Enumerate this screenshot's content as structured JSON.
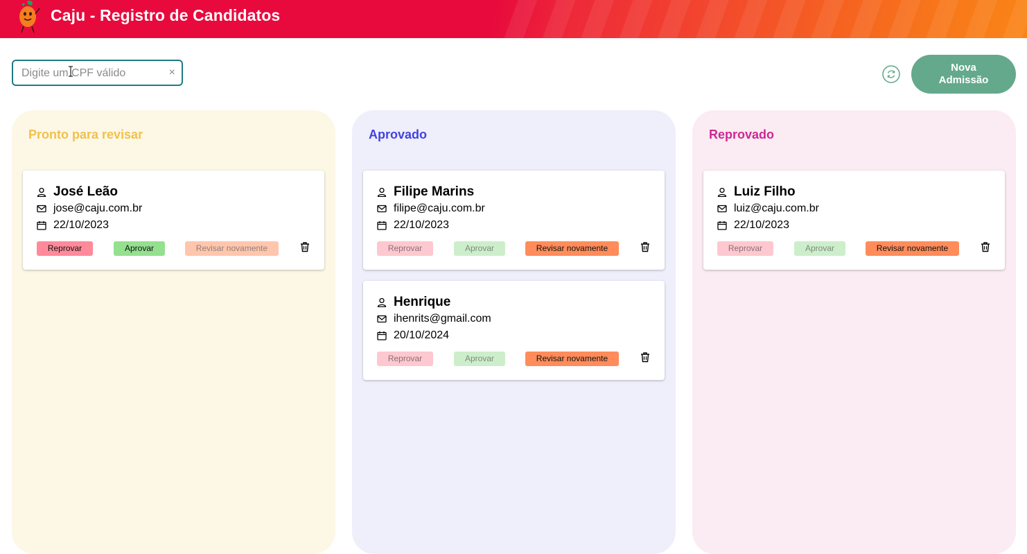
{
  "header": {
    "title": "Caju - Registro de Candidatos",
    "logo_icon": "caju-mascot-icon"
  },
  "toolbar": {
    "search_placeholder": "Digite um CPF válido",
    "search_value": "",
    "clear_icon": "×",
    "refresh_icon": "refresh-icon",
    "new_button_label": "Nova Admissão"
  },
  "colors": {
    "header_start": "#e80a3d",
    "header_end": "#fa8416",
    "accent_teal": "#1e7b84",
    "button_green": "#64a98c",
    "review_title": "#efc24b",
    "approved_title": "#4242df",
    "rejected_title": "#ce2893",
    "review_bg": "#fdf7e6",
    "approved_bg": "#efeefb",
    "rejected_bg": "#fbebf2"
  },
  "actions": {
    "reprovar": "Reprovar",
    "aprovar": "Aprovar",
    "revisar": "Revisar novamente"
  },
  "columns": [
    {
      "title": "Pronto para revisar",
      "cards": [
        {
          "name": "José Leão",
          "email": "jose@caju.com.br",
          "date": "22/10/2023"
        }
      ]
    },
    {
      "title": "Aprovado",
      "cards": [
        {
          "name": "Filipe Marins",
          "email": "filipe@caju.com.br",
          "date": "22/10/2023"
        },
        {
          "name": "Henrique",
          "email": "ihenrits@gmail.com",
          "date": "20/10/2024"
        }
      ]
    },
    {
      "title": "Reprovado",
      "cards": [
        {
          "name": "Luiz Filho",
          "email": "luiz@caju.com.br",
          "date": "22/10/2023"
        }
      ]
    }
  ]
}
